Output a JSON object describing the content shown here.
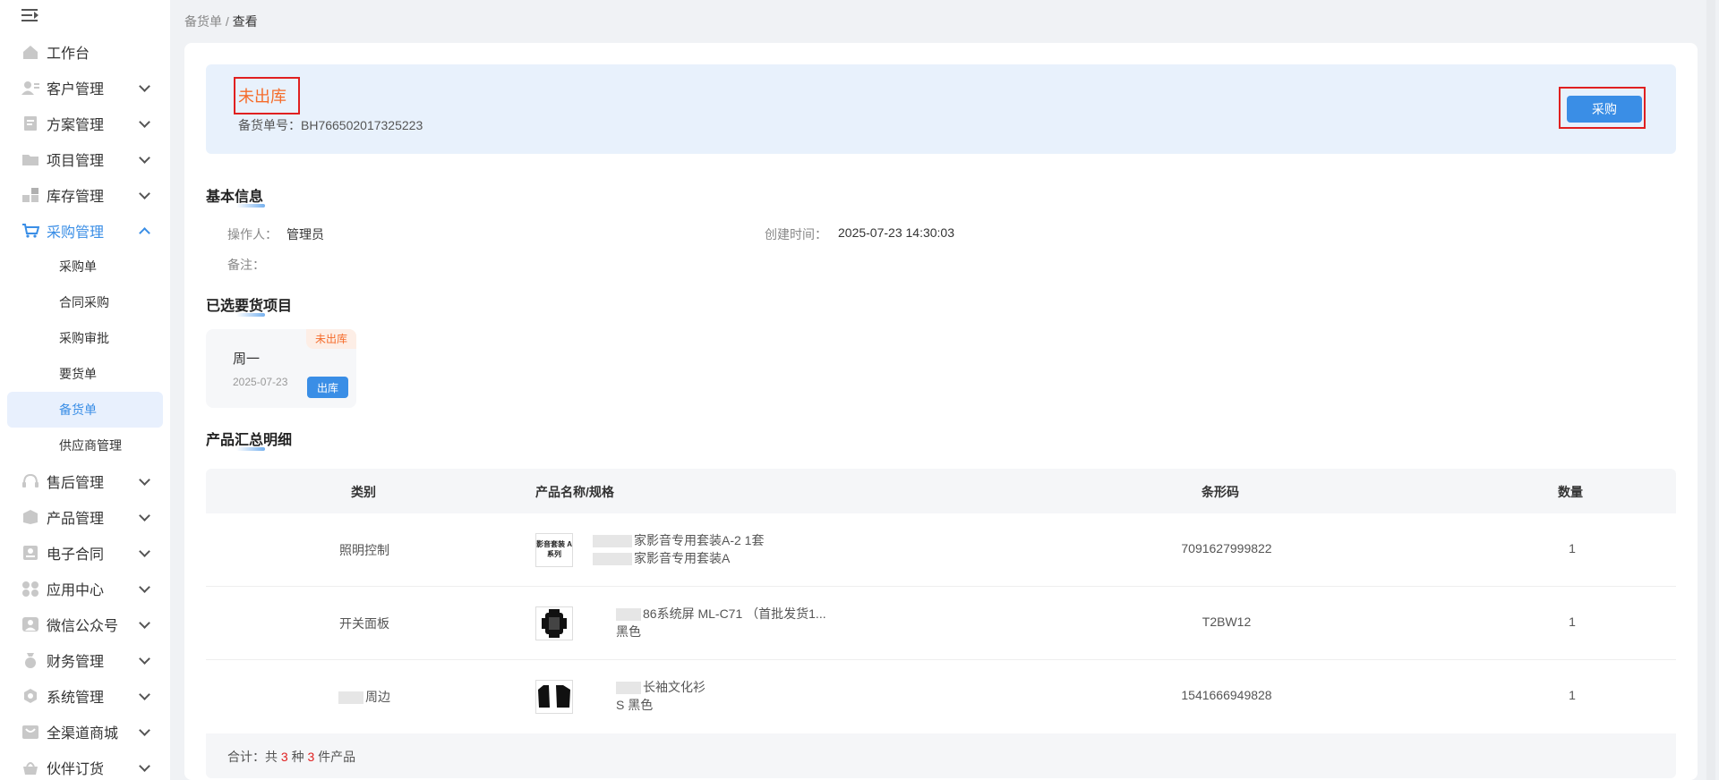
{
  "sidebar": {
    "items": [
      {
        "label": "工作台",
        "icon": "home-icon",
        "has_children": false
      },
      {
        "label": "客户管理",
        "icon": "customer-icon",
        "has_children": true
      },
      {
        "label": "方案管理",
        "icon": "document-icon",
        "has_children": true
      },
      {
        "label": "项目管理",
        "icon": "folder-icon",
        "has_children": true
      },
      {
        "label": "库存管理",
        "icon": "inventory-icon",
        "has_children": true
      },
      {
        "label": "采购管理",
        "icon": "cart-icon",
        "has_children": true,
        "open": true
      },
      {
        "label": "售后管理",
        "icon": "headset-icon",
        "has_children": true
      },
      {
        "label": "产品管理",
        "icon": "product-icon",
        "has_children": true
      },
      {
        "label": "电子合同",
        "icon": "contract-icon",
        "has_children": true
      },
      {
        "label": "应用中心",
        "icon": "apps-icon",
        "has_children": true
      },
      {
        "label": "微信公众号",
        "icon": "wechat-icon",
        "has_children": true
      },
      {
        "label": "财务管理",
        "icon": "finance-icon",
        "has_children": true
      },
      {
        "label": "系统管理",
        "icon": "settings-icon",
        "has_children": true
      },
      {
        "label": "全渠道商城",
        "icon": "mall-icon",
        "has_children": true
      },
      {
        "label": "伙伴订货",
        "icon": "partner-icon",
        "has_children": true
      }
    ],
    "purchase_sub": [
      "采购单",
      "合同采购",
      "采购审批",
      "要货单",
      "备货单",
      "供应商管理"
    ],
    "active_sub": "备货单"
  },
  "breadcrumb": {
    "parent": "备货单",
    "separator": "/",
    "current": "查看"
  },
  "banner": {
    "status": "未出库",
    "order_no_label": "备货单号：",
    "order_no": "BH766502017325223",
    "purchase_button": "采购"
  },
  "basic_info": {
    "title": "基本信息",
    "operator_label": "操作人：",
    "operator": "管理员",
    "created_label": "创建时间：",
    "created": "2025-07-23 14:30:03",
    "remark_label": "备注："
  },
  "selected_projects": {
    "title": "已选要货项目",
    "card": {
      "badge": "未出库",
      "name": "周一",
      "date": "2025-07-23",
      "button": "出库"
    }
  },
  "summary": {
    "title": "产品汇总明细",
    "columns": [
      "类别",
      "产品名称/规格",
      "条形码",
      "数量"
    ],
    "rows": [
      {
        "category": "照明控制",
        "name_line1": "家影音专用套装A-2 1套",
        "name_line2": "家影音专用套装A",
        "barcode": "7091627999822",
        "qty": "1",
        "thumb": "影音套装 A系列"
      },
      {
        "category": "开关面板",
        "name_line1": "86系统屏 ML-C71 （首批发货1...",
        "name_line2": "黑色",
        "barcode": "T2BW12",
        "qty": "1",
        "thumb": "panel-image"
      },
      {
        "category": "周边",
        "name_line1": "长袖文化衫",
        "name_line2": "S 黑色",
        "barcode": "1541666949828",
        "qty": "1",
        "thumb": "shirt-image"
      }
    ],
    "footer": {
      "prefix": "合计：共",
      "kinds": "3",
      "mid": "种",
      "pieces": "3",
      "suffix": "件产品"
    }
  },
  "colors": {
    "accent": "#3a8ee6",
    "status": "#f56c2b",
    "highlight": "#e02020"
  }
}
